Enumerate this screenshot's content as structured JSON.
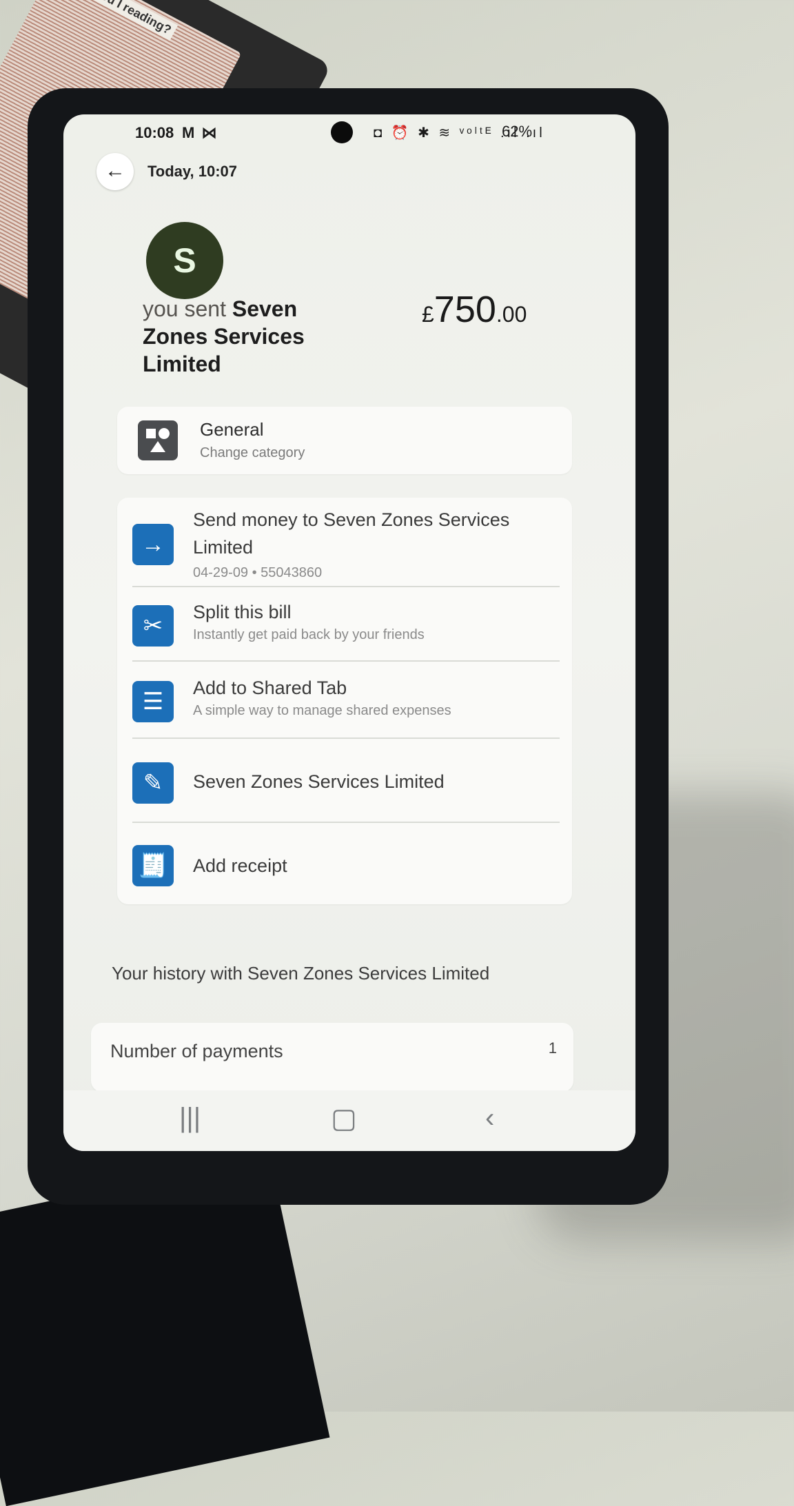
{
  "book_label": "o you I\nreading?",
  "status_bar": {
    "time": "10:08",
    "notification_icons": "M ⋈",
    "indicators": "◘ ⏰ ✱ ≋ ᵛᵒˡᵗᴱ .ıl .ıl",
    "battery": "62%"
  },
  "header": {
    "title": "Today, 10:07"
  },
  "transaction": {
    "avatar_letter": "S",
    "prefix": "you sent",
    "payee": "Seven Zones Services Limited",
    "currency": "£",
    "amount_main": "750",
    "amount_decimal": ".00"
  },
  "category": {
    "title": "General",
    "subtitle": "Change category"
  },
  "actions": [
    {
      "title": "Send money to Seven Zones Services Limited",
      "subtitle": "04-29-09 • 55043860",
      "icon": "arrow-right-icon"
    },
    {
      "title": "Split this bill",
      "subtitle": "Instantly get paid back by your friends",
      "icon": "split-bill-icon"
    },
    {
      "title": "Add to Shared Tab",
      "subtitle": "A simple way to manage shared expenses",
      "icon": "shared-tab-icon"
    },
    {
      "title": "Seven Zones Services Limited",
      "subtitle": "",
      "icon": "pencil-icon"
    },
    {
      "title": "Add receipt",
      "subtitle": "",
      "icon": "receipt-icon"
    }
  ],
  "history": {
    "title": "Your history with Seven Zones Services Limited",
    "label": "Number of payments",
    "value": "1"
  },
  "navbar": {
    "recents": "|||",
    "home": "▢",
    "back": "‹"
  }
}
